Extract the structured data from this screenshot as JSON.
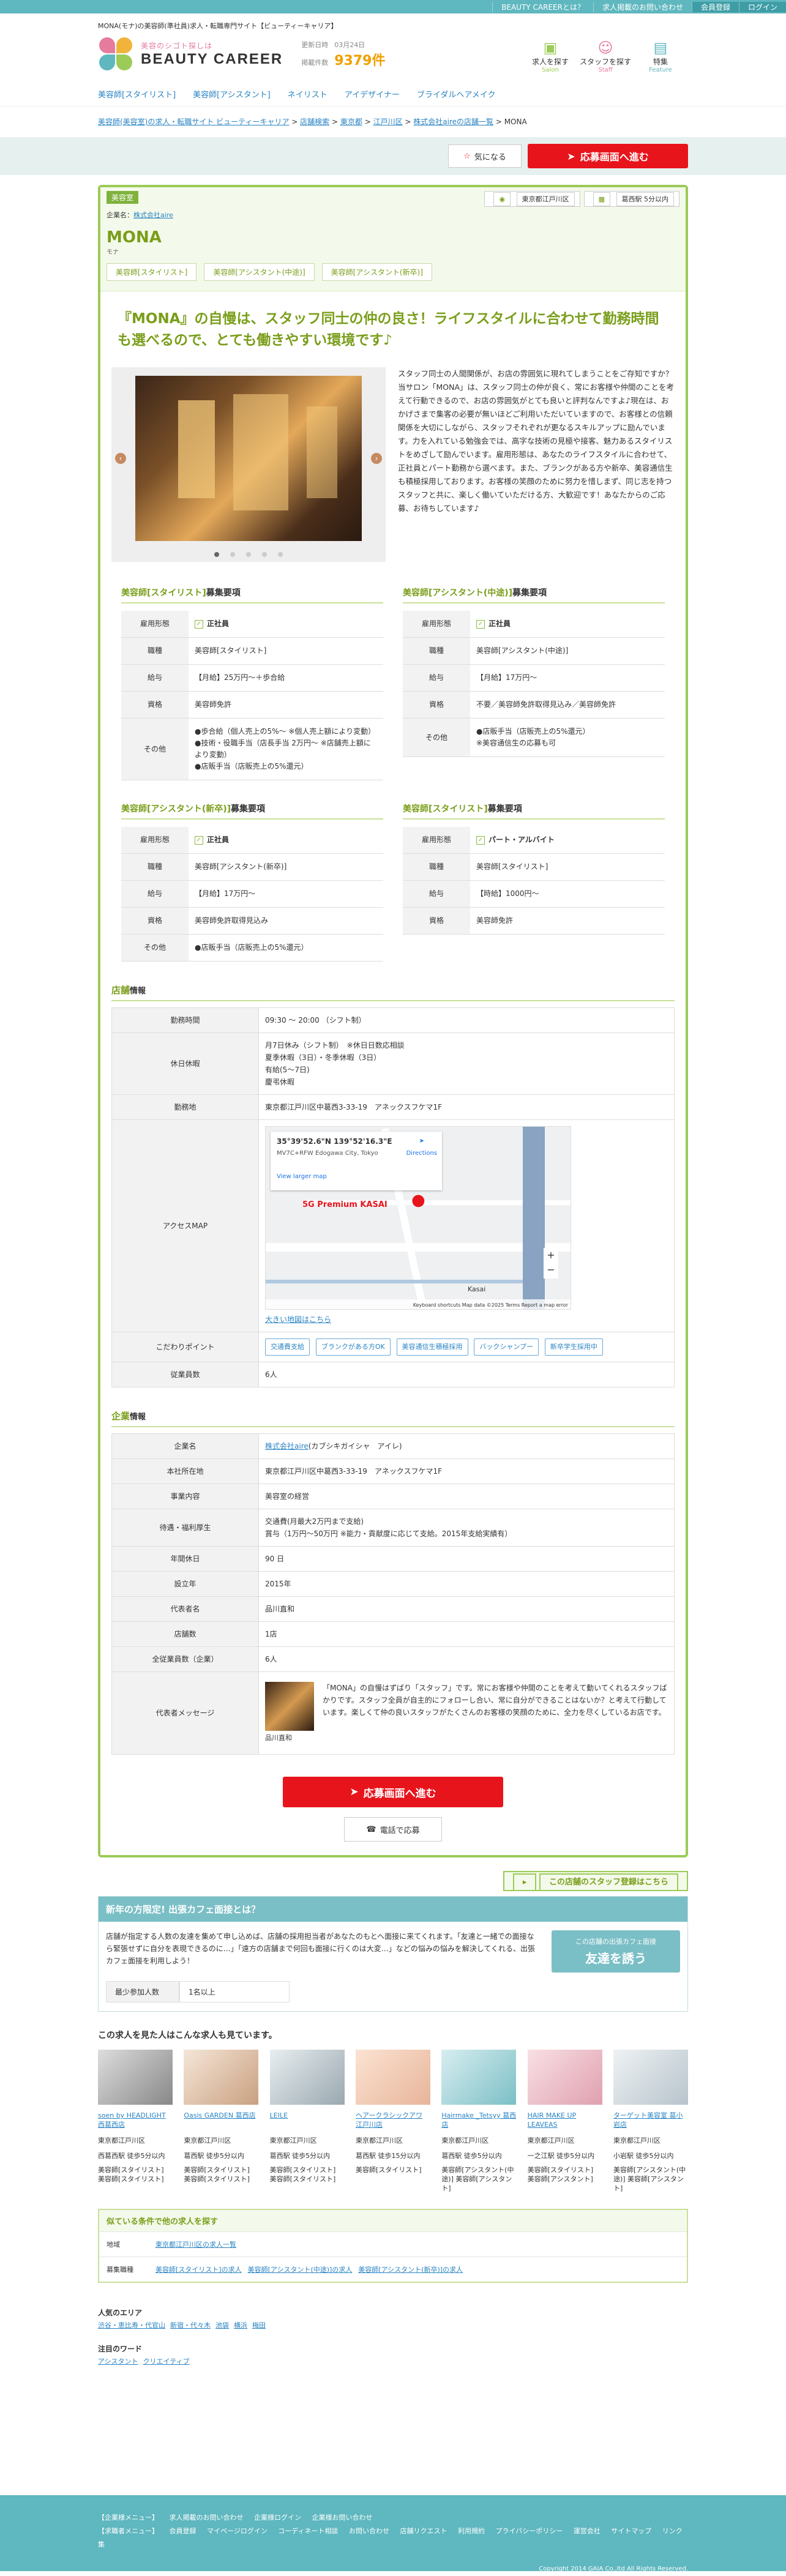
{
  "topbar": {
    "links": [
      "BEAUTY CAREERとは？",
      "求人掲載のお問い合わせ",
      "会員登録",
      "ログイン"
    ]
  },
  "subtagline": "MONA(モナ)の美容師(準社員)求人・転職専門サイト【ビューティーキャリア】",
  "logo": {
    "small": "美容のシゴト探しは",
    "big": "BEAUTY CAREER"
  },
  "stats": {
    "updated_label": "更新日時",
    "updated_value": "03月24日",
    "count_label": "掲載件数",
    "count_value": "9379件"
  },
  "header_icons": [
    {
      "label": "求人を探す",
      "en": "Salon",
      "icon": "salon-icon"
    },
    {
      "label": "スタッフを探す",
      "en": "Staff",
      "icon": "staff-icon"
    },
    {
      "label": "特集",
      "en": "Feature",
      "icon": "feature-icon"
    }
  ],
  "catnav": [
    "美容師[スタイリスト]",
    "美容師[アシスタント]",
    "ネイリスト",
    "アイデザイナー",
    "ブライダルヘアメイク"
  ],
  "breadcrumb": [
    "美容師(美容室)の求人・転職サイト ビューティーキャリア",
    "店舗検索",
    "東京都",
    "江戸川区",
    "株式会社aireの店舗一覧",
    "MONA"
  ],
  "actions": {
    "fav": "気になる",
    "apply": "応募画面へ進む"
  },
  "shop": {
    "category": "美容室",
    "corp_label": "企業名：",
    "corp_name": "株式会社aire",
    "name": "MONA",
    "kana": "モナ",
    "station": "東京都江戸川区",
    "walk": "葛西駅 5分以内",
    "job_tags": [
      "美容師[スタイリスト]",
      "美容師[アシスタント(中途)]",
      "美容師[アシスタント(新卒)]"
    ]
  },
  "catch": "『MONA』の自慢は、スタッフ同士の仲の良さ！ライフスタイルに合わせて勤務時間も選べるので、とても働きやすい環境です♪",
  "intro": "スタッフ同士の人間関係が、お店の雰囲気に現れてしまうことをご存知ですか？当サロン「MONA」は、スタッフ同士の仲が良く、常にお客様や仲間のことを考えて行動できるので、お店の雰囲気がとても良いと評判なんですよ♪現在は、おかげさまで集客の必要が無いほどご利用いただいていますので、お客様との信頼関係を大切にしながら、スタッフそれぞれが更なるスキルアップに励んでいます。力を入れている勉強会では、高字な技術の見極や接客、魅力あるスタイリストをめざして励んでいます。雇用形態は、あなたのライフスタイルに合わせて、正社員とパート勤務から選べます。また、ブランクがある方や新卒、美容通信生も積極採用しております。お客様の笑顔のために努力を惜しまず、同じ志を持つスタッフと共に、楽しく働いていただける方、大歓迎です！あなたからのご応募、お待ちしています♪",
  "req_suffix": "募集要項",
  "reqs": [
    {
      "title": "美容師[スタイリスト]",
      "rows": [
        {
          "k": "雇用形態",
          "v": "正社員",
          "chk": true
        },
        {
          "k": "職種",
          "v": "美容師[スタイリスト]"
        },
        {
          "k": "給与",
          "v": "【月給】25万円〜＋歩合給"
        },
        {
          "k": "資格",
          "v": "美容師免許"
        },
        {
          "k": "その他",
          "v": "●歩合給（個人売上の5%〜 ※個人売上額により変動）\n●技術・役職手当（店長手当 2万円〜 ※店舗売上額により変動）\n●店販手当（店販売上の5%還元）"
        }
      ]
    },
    {
      "title": "美容師[アシスタント(中途)]",
      "rows": [
        {
          "k": "雇用形態",
          "v": "正社員",
          "chk": true
        },
        {
          "k": "職種",
          "v": "美容師[アシスタント(中途)]"
        },
        {
          "k": "給与",
          "v": "【月給】17万円〜"
        },
        {
          "k": "資格",
          "v": "不要／美容師免許取得見込み／美容師免許"
        },
        {
          "k": "その他",
          "v": "●店販手当（店販売上の5%還元）\n※美容通信生の応募も可"
        }
      ]
    },
    {
      "title": "美容師[アシスタント(新卒)]",
      "rows": [
        {
          "k": "雇用形態",
          "v": "正社員",
          "chk": true
        },
        {
          "k": "職種",
          "v": "美容師[アシスタント(新卒)]"
        },
        {
          "k": "給与",
          "v": "【月給】17万円〜"
        },
        {
          "k": "資格",
          "v": "美容師免許取得見込み"
        },
        {
          "k": "その他",
          "v": "●店販手当（店販売上の5%還元）"
        }
      ]
    },
    {
      "title": "美容師[スタイリスト]",
      "rows": [
        {
          "k": "雇用形態",
          "v": "パート・アルバイト",
          "chk": true
        },
        {
          "k": "職種",
          "v": "美容師[スタイリスト]"
        },
        {
          "k": "給与",
          "v": "【時給】1000円〜"
        },
        {
          "k": "資格",
          "v": "美容師免許"
        }
      ]
    }
  ],
  "store_info": {
    "title": "店舗",
    "suffix": "情報",
    "hours_k": "勤務時間",
    "hours_v": "09:30 〜 20:00 （シフト制）",
    "holiday_k": "休日休暇",
    "holiday_v": "月7日休み（シフト制）　※休日日数応相談\n夏季休暇（3日）・冬季休暇（3日）\n有給(5〜7日)\n慶弔休暇",
    "address_k": "勤務地",
    "address_v": "東京都江戸川区中葛西3-33-19　アネックスフケマ1F",
    "map_k": "アクセスMAP",
    "map_coords": "35°39'52.6\"N 139°52'16.3\"E",
    "map_addr": "MV7C+RFW Edogawa City, Tokyo",
    "map_dir": "Directions",
    "map_larger": "View larger map",
    "map_place": "5G Premium KASAI",
    "map_station": "Kasai",
    "map_footer": "Keyboard shortcuts   Map data ©2025   Terms   Report a map error",
    "map_link": "大きい地図はこちら",
    "points_k": "こだわりポイント",
    "points": [
      "交通費支給",
      "ブランクがある方OK",
      "美容通信生積極採用",
      "バックシャンプー",
      "新卒学生採用中"
    ],
    "staff_k": "従業員数",
    "staff_v": "6人"
  },
  "company_info": {
    "title": "企業",
    "suffix": "情報",
    "rows": [
      {
        "k": "企業名",
        "v": "株式会社aire",
        "v2": "(カブシキガイシャ　アイレ)"
      },
      {
        "k": "本社所在地",
        "v": "東京都江戸川区中葛西3-33-19　アネックスフケマ1F"
      },
      {
        "k": "事業内容",
        "v": "美容室の経営"
      },
      {
        "k": "待遇・福利厚生",
        "v": "交通費(月最大2万円まで支給)\n賞与（1万円〜50万円 ※能力・貢献度に応じて支給。2015年支給実績有）"
      },
      {
        "k": "年間休日",
        "v": "90 日"
      },
      {
        "k": "設立年",
        "v": "2015年"
      },
      {
        "k": "代表者名",
        "v": "品川直和"
      },
      {
        "k": "店舗数",
        "v": "1店"
      },
      {
        "k": "全従業員数（企業）",
        "v": "6人"
      }
    ],
    "msg_k": "代表者メッセージ",
    "msg_v": "「MONA」の自慢はずばり「スタッフ」です。常にお客様や仲間のことを考えて動いてくれるスタッフばかりです。スタッフ全員が自主的にフォローし合い、常に自分ができることはないか？と考えて行動しています。楽しくて仲の良いスタッフがたくさんのお客様の笑顔のために、全力を尽くしているお店です。",
    "msg_name": "品川直和"
  },
  "apply_big": "応募画面へ進む",
  "tel": "電話で応募",
  "staff_reg": "この店舗のスタッフ登録はこちら",
  "friend": {
    "title": "新年の方限定! 出張カフェ面接とは？",
    "text": "店舗が指定する人数の友達を集めて申し込めば、店舗の採用担当者があなたのもとへ面接に来てくれます。「友達と一緒での面接なら緊張せずに自分を表現できるのに…」「遠方の店舗まで何回も面接に行くのは大変…」などの悩みの悩みを解決してくれる、出張カフェ面接を利用しよう！",
    "btn_small": "この店舗の出張カフェ面接",
    "btn_big": "友達を誘う",
    "min_k": "最少参加人数",
    "min_v": "1名以上"
  },
  "similar": {
    "title": "この求人を見た人はこんな求人も見ています。",
    "items": [
      {
        "name": "soen by HEADLIGHT 西葛西店",
        "loc": "東京都江戸川区",
        "st": "西葛西駅 徒歩5分以内",
        "jb": "美容師[スタイリスト] 美容師[スタイリスト]"
      },
      {
        "name": "Oasis GARDEN 葛西店",
        "loc": "東京都江戸川区",
        "st": "葛西駅 徒歩5分以内",
        "jb": "美容師[スタイリスト] 美容師[スタイリスト]"
      },
      {
        "name": "LEILE",
        "loc": "東京都江戸川区",
        "st": "葛西駅 徒歩5分以内",
        "jb": "美容師[スタイリスト] 美容師[スタイリスト]"
      },
      {
        "name": "ヘアークラシックアワ 江戸川店",
        "loc": "東京都江戸川区",
        "st": "葛西駅 徒歩15分以内",
        "jb": "美容師[スタイリスト]"
      },
      {
        "name": "Hairmake _Tetsyy 葛西店",
        "loc": "東京都江戸川区",
        "st": "葛西駅 徒歩5分以内",
        "jb": "美容師[アシスタント(中途)] 美容師[アシスタント]"
      },
      {
        "name": "HAIR MAKE UP LEAVEAS",
        "loc": "東京都江戸川区",
        "st": "一之江駅 徒歩5分以内",
        "jb": "美容師[スタイリスト] 美容師[アシスタント]"
      },
      {
        "name": "ターゲット美容室 葛小岩店",
        "loc": "東京都江戸川区",
        "st": "小岩駅 徒歩5分以内",
        "jb": "美容師[アシスタント(中途)] 美容師[アシスタント]"
      }
    ]
  },
  "search": {
    "title": "似ている条件で他の求人を探す",
    "area_k": "地域",
    "area_v": [
      "東京都江戸川区の求人一覧"
    ],
    "job_k": "募集職種",
    "job_v": [
      "美容師[スタイリスト]の求人",
      "美容師[アシスタント(中途)]の求人",
      "美容師[アシスタント(新卒)]の求人"
    ]
  },
  "popular_area": {
    "title": "人気のエリア",
    "items": [
      "渋谷・恵比寿・代官山",
      "新宿・代々木",
      "池袋",
      "横浜",
      "梅田"
    ]
  },
  "popular_word": {
    "title": "注目のワード",
    "items": [
      "アシスタント",
      "クリエイティブ"
    ]
  },
  "footer": {
    "row1": [
      "【企業様メニュー】",
      "求人掲載のお問い合わせ",
      "企業様ログイン",
      "企業様お問い合わせ"
    ],
    "row2": [
      "【求職者メニュー】",
      "会員登録",
      "マイページログイン",
      "コーディネート相談",
      "お問い合わせ",
      "店舗リクエスト",
      "利用規約",
      "プライバシーポリシー",
      "運営会社",
      "サイトマップ",
      "リンク集"
    ],
    "copy": "Copyright 2014 GAIA Co.,ltd All Rights Reserved."
  },
  "colors": {
    "accent": "#9ccb58",
    "brand": "#5fb7bf",
    "cta": "#e8141c"
  }
}
